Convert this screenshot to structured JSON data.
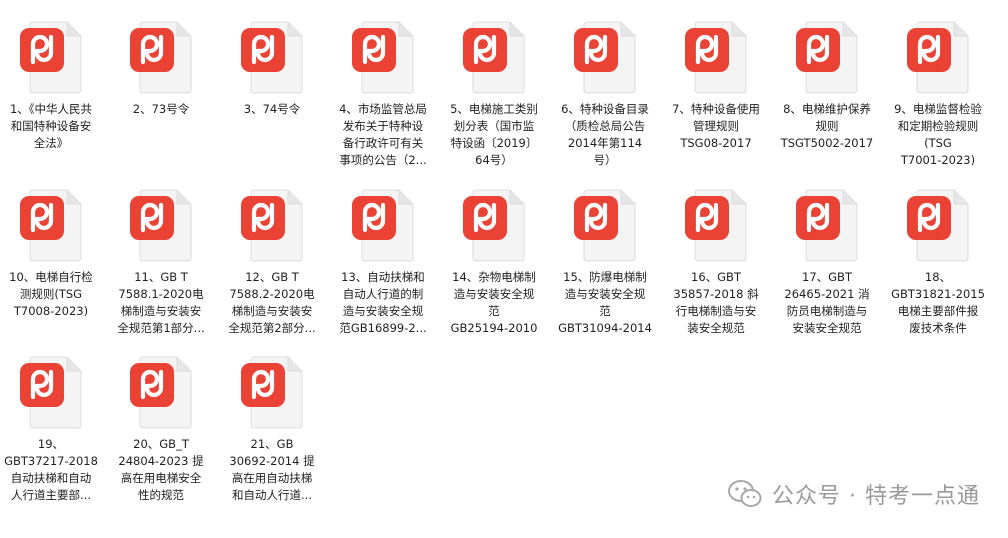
{
  "files": [
    {
      "name": "1、《中华人民共\n和国特种设备安\n全法》"
    },
    {
      "name": "2、73号令"
    },
    {
      "name": "3、74号令"
    },
    {
      "name": "4、市场监管总局\n发布关于特种设\n备行政许可有关\n事项的公告（2..."
    },
    {
      "name": "5、电梯施工类别\n划分表（国市监\n特设函〔2019〕\n64号）"
    },
    {
      "name": "6、特种设备目录\n（质检总局公告\n2014年第114\n号）"
    },
    {
      "name": "7、特种设备使用\n管理规则\nTSG08-2017"
    },
    {
      "name": "8、电梯维护保养\n规则\nTSGT5002-2017"
    },
    {
      "name": "9、电梯监督检验\n和定期检验规则\n(TSG\nT7001-2023)"
    },
    {
      "name": "10、电梯自行检\n测规则(TSG\nT7008-2023)"
    },
    {
      "name": "11、GB T\n7588.1-2020电\n梯制造与安装安\n全规范第1部分..."
    },
    {
      "name": "12、GB T\n7588.2-2020电\n梯制造与安装安\n全规范第2部分..."
    },
    {
      "name": "13、自动扶梯和\n自动人行道的制\n造与安装安全规\n范GB16899-2..."
    },
    {
      "name": "14、杂物电梯制\n造与安装安全规\n范\nGB25194-2010"
    },
    {
      "name": "15、防爆电梯制\n造与安装安全规\n范\nGBT31094-2014"
    },
    {
      "name": "16、GBT\n35857-2018 斜\n行电梯制造与安\n装安全规范"
    },
    {
      "name": "17、GBT\n26465-2021 消\n防员电梯制造与\n安装安全规范"
    },
    {
      "name": "18、\nGBT31821-2015\n电梯主要部件报\n废技术条件"
    },
    {
      "name": "19、\nGBT37217-2018\n自动扶梯和自动\n人行道主要部..."
    },
    {
      "name": "20、GB_T\n24804-2023 提\n高在用电梯安全\n性的规范"
    },
    {
      "name": "21、GB\n30692-2014 提\n高在用自动扶梯\n和自动人行道..."
    }
  ],
  "watermark": {
    "text": "公众号 · 特考一点通",
    "icon": "wechat-icon"
  },
  "colors": {
    "icon_red": "#ea4335",
    "page_fold": "#e6e6e6",
    "label": "#1f1f1f"
  }
}
